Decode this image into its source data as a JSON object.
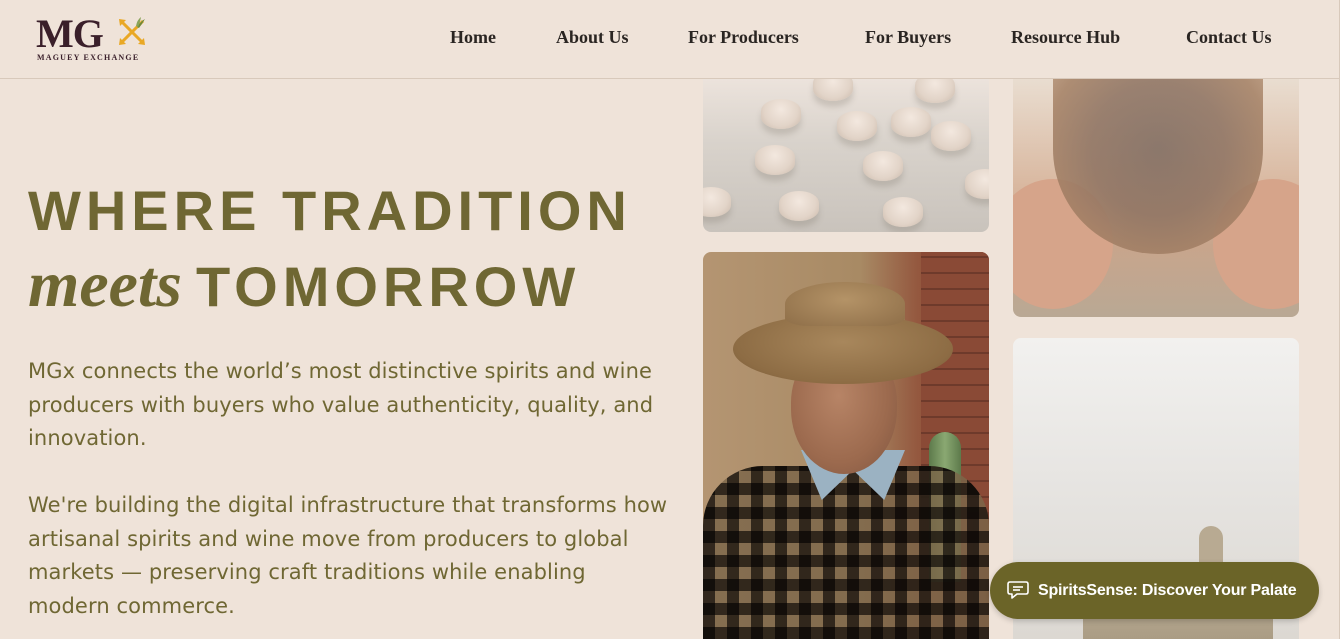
{
  "logo": {
    "mark": "MG",
    "subtitle": "MAGUEY EXCHANGE",
    "accent_color": "#e9a825"
  },
  "nav": {
    "items": [
      {
        "label": "Home"
      },
      {
        "label": "About Us"
      },
      {
        "label": "For Producers"
      },
      {
        "label": "For Buyers"
      },
      {
        "label": "Resource Hub"
      },
      {
        "label": "Contact Us"
      }
    ]
  },
  "hero": {
    "title_line1": "WHERE TRADITION",
    "title_italic": "meets",
    "title_word": "TOMORROW",
    "paragraph1": "MGx connects the world’s most distinctive spirits and wine producers with buyers who value authenticity, quality, and innovation.",
    "paragraph2": "We're building the digital infrastructure that transforms how artisanal spirits and wine move from producers to global markets — preserving craft traditions while enabling modern commerce."
  },
  "gallery": {
    "tiles": [
      {
        "name": "bottles-photo"
      },
      {
        "name": "bowl-photo"
      },
      {
        "name": "farmer-photo"
      },
      {
        "name": "church-photo"
      }
    ]
  },
  "chat": {
    "label": "SpiritsSense: Discover Your Palate",
    "icon": "chat-bubble-icon",
    "bg_color": "#6b6428"
  },
  "colors": {
    "background": "#efe3d9",
    "heading": "#6f6733",
    "nav_text": "#2a2522",
    "logo_text": "#3a1f2a"
  }
}
